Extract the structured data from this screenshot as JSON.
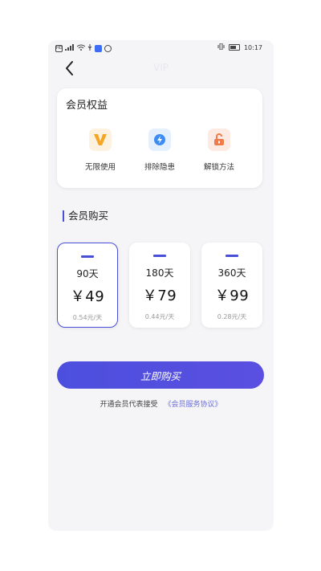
{
  "status_bar": {
    "left_icons": [
      "HD",
      "4G-signal-icon",
      "wifi-icon",
      "usb-icon",
      "app-icon",
      "app-icon-2"
    ],
    "time": "10:17"
  },
  "header": {
    "title": "VIP",
    "back_icon": "chevron-left-icon"
  },
  "benefits": {
    "title": "会员权益",
    "items": [
      {
        "label": "无限使用",
        "icon": "v-badge-icon",
        "color": "#f5a623"
      },
      {
        "label": "排除隐患",
        "icon": "lightning-icon",
        "color": "#3d8df5"
      },
      {
        "label": "解锁方法",
        "icon": "unlock-icon",
        "color": "#f07a4a"
      }
    ]
  },
  "purchase": {
    "section_title": "会员购买",
    "plans": [
      {
        "days": "90天",
        "price": "￥49",
        "unit_price": "0.54元/天",
        "selected": true
      },
      {
        "days": "180天",
        "price": "￥79",
        "unit_price": "0.44元/天",
        "selected": false
      },
      {
        "days": "360天",
        "price": "￥99",
        "unit_price": "0.28元/天",
        "selected": false
      }
    ],
    "buy_button": "立即购买",
    "agreement_text": "开通会员代表接受",
    "agreement_link": "《会员服务协议》"
  },
  "colors": {
    "accent": "#4a4fd8",
    "background": "#f5f5f7"
  }
}
